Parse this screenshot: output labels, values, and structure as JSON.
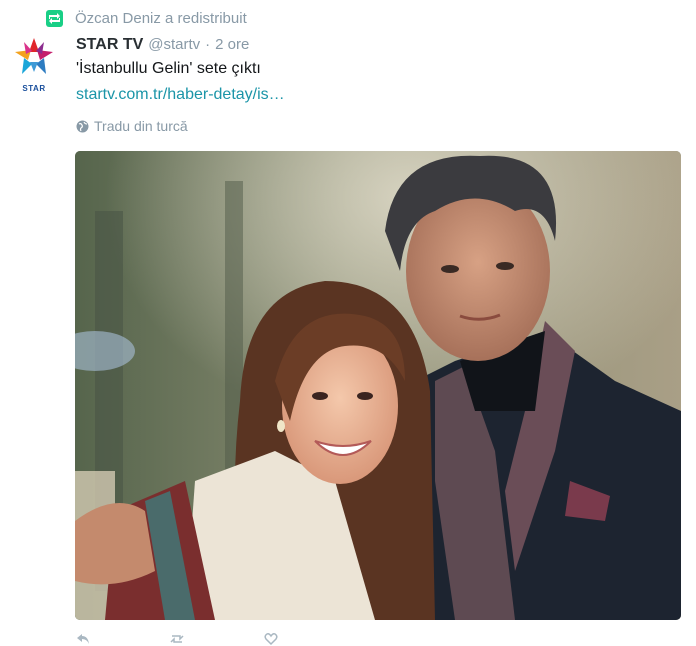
{
  "retweet": {
    "text": "Özcan Deniz a redistribuit"
  },
  "avatar": {
    "label": "STAR"
  },
  "tweet": {
    "display_name": "STAR TV",
    "screen_name": "@startv",
    "separator": "·",
    "timestamp": "2 ore",
    "text": "'İstanbullu Gelin' sete çıktı",
    "link": "startv.com.tr/haber-detay/is…",
    "translate": "Tradu din turcă"
  },
  "colors": {
    "retweet_green": "#19cf86",
    "link": "#1b95a8",
    "muted": "#8899a6"
  },
  "icons": {
    "retweet": "retweet-icon",
    "globe": "globe-icon",
    "reply": "reply-icon",
    "retweet_action": "retweet-action-icon",
    "like": "heart-icon"
  }
}
